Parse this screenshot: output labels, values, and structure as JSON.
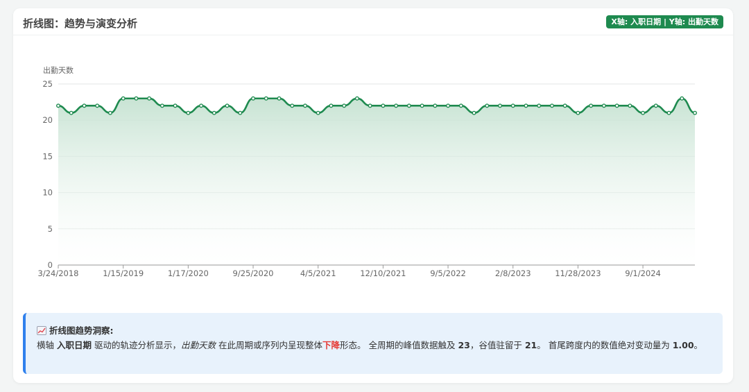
{
  "header": {
    "title": "折线图：趋势与演变分析",
    "axis_badge": "X轴: 入职日期 | Y轴: 出勤天数"
  },
  "colors": {
    "line": "#1e8a4f",
    "area_top": "#c5e2d1",
    "badge": "#1e8a4f",
    "insight_bg": "#e8f2fc",
    "insight_border": "#2f80ed",
    "down": "#e53935"
  },
  "chart_data": {
    "type": "area",
    "ylabel": "出勤天数",
    "xlabel": "",
    "ylim": [
      0,
      25
    ],
    "yticks": [
      0,
      5,
      10,
      15,
      20,
      25
    ],
    "xtick_labels": [
      "3/24/2018",
      "1/15/2019",
      "1/17/2020",
      "9/25/2020",
      "4/5/2021",
      "12/10/2021",
      "9/5/2022",
      "2/8/2023",
      "11/28/2023",
      "9/1/2024"
    ],
    "grid": "horizontal",
    "values": [
      22,
      21,
      22,
      22,
      21,
      23,
      23,
      23,
      22,
      22,
      21,
      22,
      21,
      22,
      21,
      23,
      23,
      23,
      22,
      22,
      21,
      22,
      22,
      23,
      22,
      22,
      22,
      22,
      22,
      22,
      22,
      22,
      21,
      22,
      22,
      22,
      22,
      22,
      22,
      22,
      21,
      22,
      22,
      22,
      22,
      21,
      22,
      21,
      23,
      21
    ]
  },
  "insight": {
    "icon": "chart-increasing-icon",
    "title": "折线图趋势洞察:",
    "p1": "横轴 ",
    "x_name": "入职日期",
    "p2": " 驱动的轨迹分析显示，",
    "y_name": "出勤天数",
    "p3": " 在此周期或序列内呈现整体",
    "trend": "下降",
    "p4": "形态。 全周期的峰值数据触及 ",
    "peak": "23",
    "p5": "，谷值驻留于 ",
    "trough": "21",
    "p6": "。 首尾跨度内的数值绝对变动量为 ",
    "change": "1.00",
    "p7": "。"
  }
}
